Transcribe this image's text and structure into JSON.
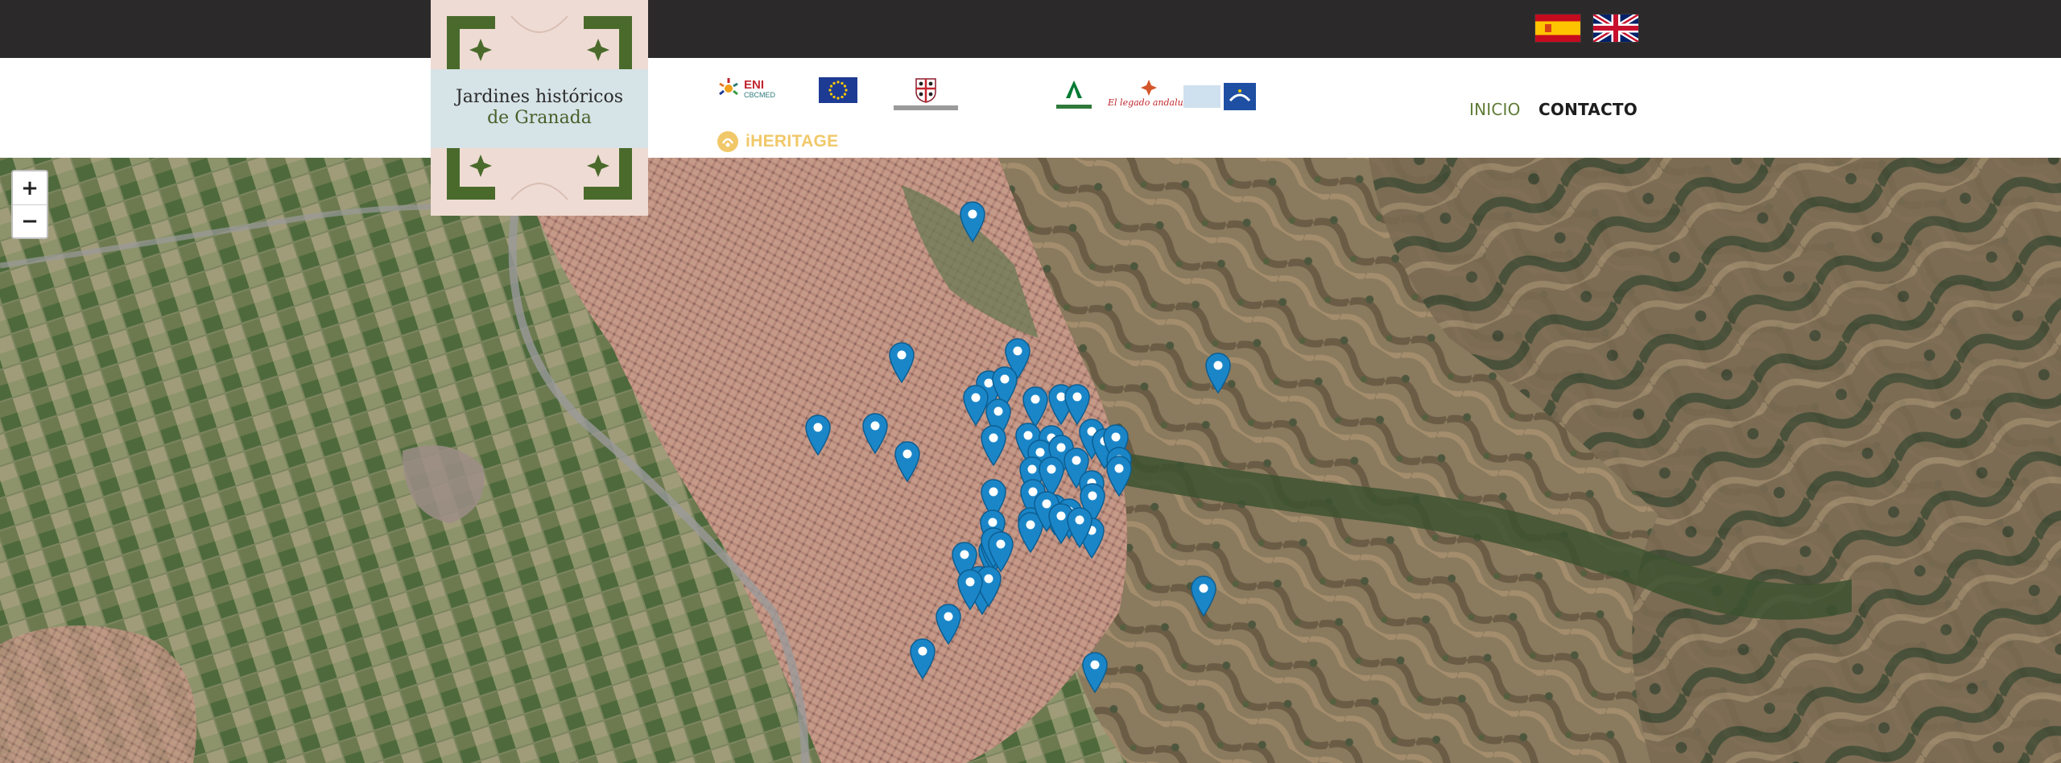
{
  "site": {
    "title_line1": "Jardines históricos",
    "title_line2": "de Granada"
  },
  "languages": [
    {
      "code": "es",
      "icon": "spain-flag-icon"
    },
    {
      "code": "en",
      "icon": "uk-flag-icon"
    }
  ],
  "nav": {
    "inicio": "INICIO",
    "contacto": "CONTACTO"
  },
  "partners": {
    "eni_word": "ENI",
    "eni_sub": "CBCMED",
    "iheritage": "iHERITAGE",
    "fundacion_sub": "El legado andalusí"
  },
  "zoom": {
    "in_label": "+",
    "out_label": "−"
  },
  "map": {
    "marker_color": "#1a86c8",
    "marker_count": 53
  },
  "colors": {
    "topbar": "#2b292a",
    "nav_active": "#5f7a35",
    "nav_default": "#1d1d1d",
    "iheritage": "#f1c869"
  }
}
